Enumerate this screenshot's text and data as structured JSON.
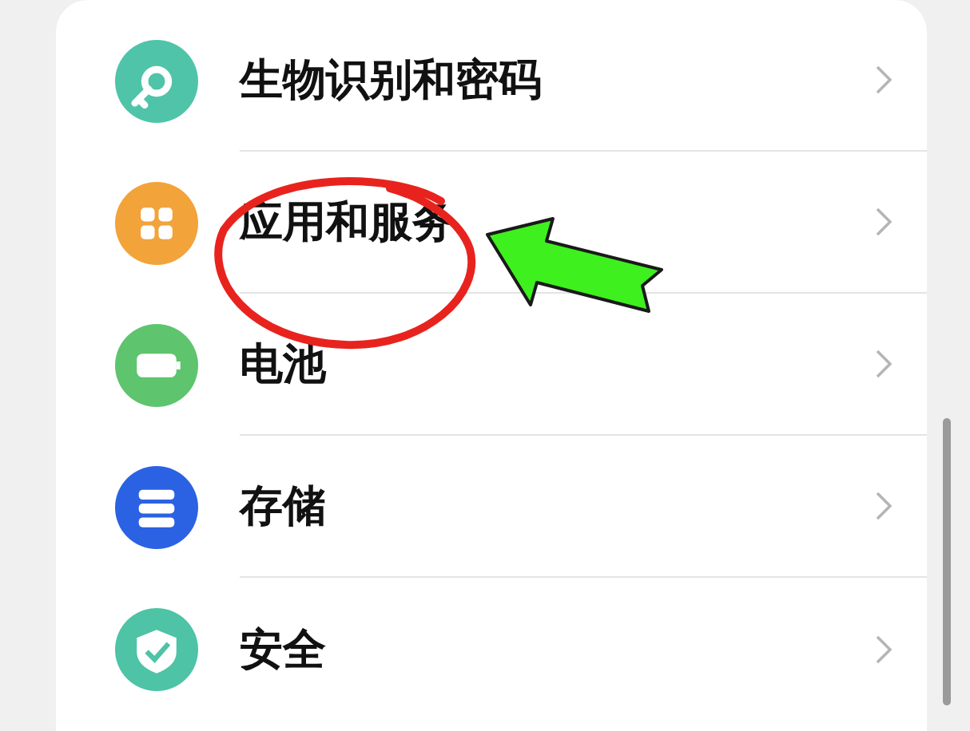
{
  "settings": {
    "items": [
      {
        "label": "生物识别和密码",
        "color": "#4fc4a9"
      },
      {
        "label": "应用和服务",
        "color": "#f2a33a"
      },
      {
        "label": "电池",
        "color": "#5ec46e"
      },
      {
        "label": "存储",
        "color": "#2b62e3"
      },
      {
        "label": "安全",
        "color": "#4ec3a6"
      }
    ]
  },
  "annotations": [
    {
      "kind": "ellipse"
    },
    {
      "kind": "arrow"
    }
  ]
}
